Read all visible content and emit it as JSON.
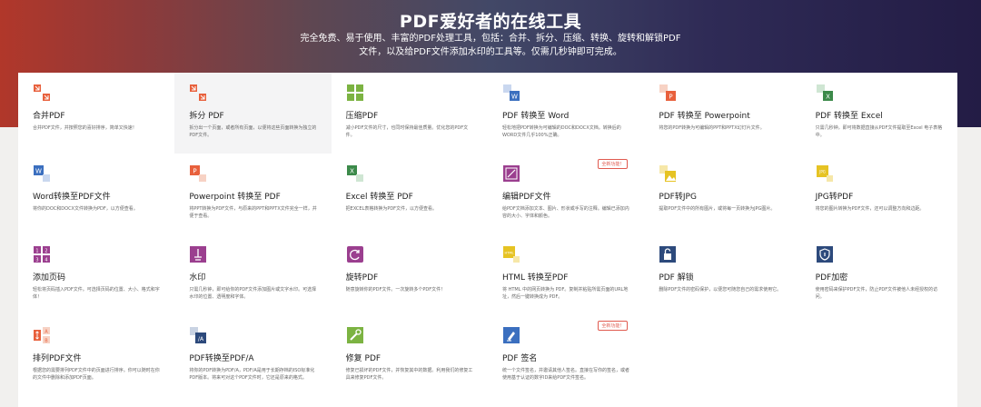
{
  "hero": {
    "title": "PDF爱好者的在线工具",
    "subtitle": "完全免费、易于使用、丰富的PDF处理工具，包括：合并、拆分、压缩、转换、旋转和解锁PDF文件，以及给PDF文件添加水印的工具等。仅需几秒钟即可完成。"
  },
  "tools": [
    {
      "title": "合并PDF",
      "desc": "合并PDF文件，并按照您的喜好排序，简单又快速！",
      "icon": "merge-icon",
      "color": "#e8603c"
    },
    {
      "title": "拆分 PDF",
      "desc": "拆分出一个页面，或者所有页面，以便将这些页面转换为独立的PDF文件。",
      "icon": "split-icon",
      "color": "#e8603c"
    },
    {
      "title": "压缩PDF",
      "desc": "减小PDF文件的尺寸，也同时保持最佳质量。优化您的PDF文件。",
      "icon": "compress-icon",
      "color": "#7cb342"
    },
    {
      "title": "PDF 转换至 Word",
      "desc": "轻松地把PDF转换为可编辑的DOC和DOCX文档。转换后的WORD文件几乎100%正确。",
      "icon": "pdf-to-word-icon",
      "color": "#3b6fbf"
    },
    {
      "title": "PDF 转换至 Powerpoint",
      "desc": "将您的PDF转换为可编辑的PPT和PPTX幻灯片文件。",
      "icon": "pdf-to-powerpoint-icon",
      "color": "#e8603c"
    },
    {
      "title": "PDF 转换至 Excel",
      "desc": "只需几秒钟，即可将数据直接从PDF文件提取至Excel 电子表格中。",
      "icon": "pdf-to-excel-icon",
      "color": "#3c8a4a"
    },
    {
      "title": "Word转换至PDF文件",
      "desc": "将你的DOC和DOCX文件转换为PDF，以方便查看。",
      "icon": "word-to-pdf-icon",
      "color": "#3b6fbf"
    },
    {
      "title": "Powerpoint 转换至 PDF",
      "desc": "将PPT转换为PDF文件，与原来的PPT和PPTX文件完全一样，并便于查看。",
      "icon": "powerpoint-to-pdf-icon",
      "color": "#e8603c"
    },
    {
      "title": "Excel 转换至 PDF",
      "desc": "把EXCEL表格转换为PDF文件，以方便查看。",
      "icon": "excel-to-pdf-icon",
      "color": "#3c8a4a"
    },
    {
      "title": "编辑PDF文件",
      "desc": "给PDF文档添加文本、图片、形状或手写的注释。编辑已添加内容的大小、字体和颜色。",
      "icon": "edit-pdf-icon",
      "color": "#9b3f8f",
      "badge": "全新功能！"
    },
    {
      "title": "PDF转JPG",
      "desc": "提取PDF文件中的所有图片，或将每一页转换为JPG图片。",
      "icon": "pdf-to-jpg-icon",
      "color": "#e6c323"
    },
    {
      "title": "JPG转PDF",
      "desc": "将您的图片转换为PDF文件，还可以调整方向和边距。",
      "icon": "jpg-to-pdf-icon",
      "color": "#e6c323"
    },
    {
      "title": "添加页码",
      "desc": "轻松将页码插入PDF文件。可选择页码的位置、大小、格式和字体！",
      "icon": "page-numbers-icon",
      "color": "#9b3f8f"
    },
    {
      "title": "水印",
      "desc": "只需几秒钟，即可给你的PDF文件添加图片或文字水印。可选择水印的位置、透明度和字体。",
      "icon": "watermark-icon",
      "color": "#9b3f8f"
    },
    {
      "title": "旋转PDF",
      "desc": "随意旋转你的PDF文件。一次旋转多个PDF文件！",
      "icon": "rotate-icon",
      "color": "#9b3f8f"
    },
    {
      "title": "HTML 转换至PDF",
      "desc": "将 HTML 中的网页转换为 PDF。复制并粘贴所需页面的URL地址，然后一键转换成为 PDF。",
      "icon": "html-to-pdf-icon",
      "color": "#e6c323"
    },
    {
      "title": "PDF 解锁",
      "desc": "删除PDF文件的密码保护，以便您可随您自己的需求使用它。",
      "icon": "unlock-icon",
      "color": "#2d4a7c"
    },
    {
      "title": "PDF加密",
      "desc": "使用密码来保护PDF文件，防止PDF文件被他人未经授权的访问。",
      "icon": "protect-icon",
      "color": "#2d4a7c"
    },
    {
      "title": "排列PDF文件",
      "desc": "根据您的需要排列PDF文件中的页面进行排序。你可以随时在你的文件中删除和添加PDF页面。",
      "icon": "organize-icon",
      "color": "#e8603c"
    },
    {
      "title": "PDF转换至PDF/A",
      "desc": "将你的PDF转换为PDF/A，PDF/A是用于长期存档的ISO标准化PDF版本。将来可对这个PDF文件时，它还是原来的格式。",
      "icon": "pdfa-icon",
      "color": "#2d4a7c"
    },
    {
      "title": "修复 PDF",
      "desc": "修复已损坏的PDF文件，并恢复其中的数据。利用我们的修复工具来修复PDF文件。",
      "icon": "repair-icon",
      "color": "#7cb342"
    },
    {
      "title": "PDF 签名",
      "desc": "统一个文件签名，并邀请其他人签名。直接在写你的签名，或者使用基于认证的数字ID来给PDF文件签名。",
      "icon": "sign-icon",
      "color": "#3b6fbf",
      "badge": "全新功能！"
    }
  ]
}
